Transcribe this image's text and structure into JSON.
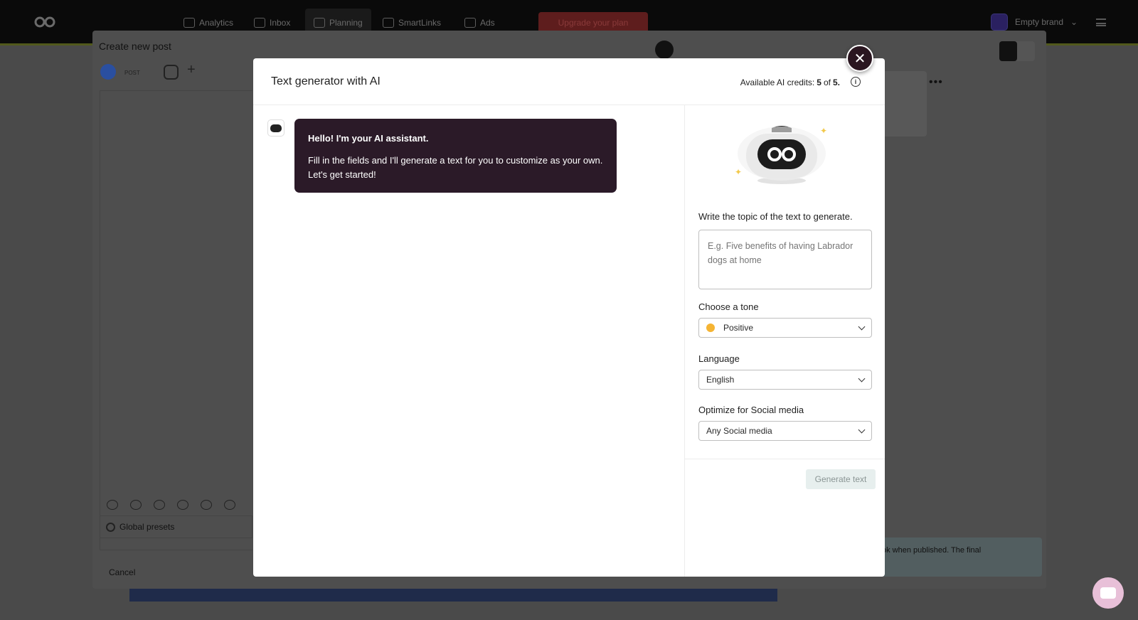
{
  "nav": {
    "items": [
      "Analytics",
      "Inbox",
      "Planning",
      "SmartLinks",
      "Ads"
    ],
    "upgrade_label": "Upgrade your plan",
    "brand_label": "Empty brand"
  },
  "create_post": {
    "title": "Create new post",
    "post_type": "POST",
    "global_presets": "Global presets",
    "cancel": "Cancel",
    "note_text": "ok when published. The final"
  },
  "ai_modal": {
    "title": "Text generator with AI",
    "credits_prefix": "Available AI credits:",
    "credits_used": "5",
    "credits_of": "of",
    "credits_total": "5.",
    "greeting": "Hello! I'm your AI assistant.",
    "intro": "Fill in the fields and I'll generate a text for you to customize as your own. Let's get started!",
    "topic_label": "Write the topic of the text to generate.",
    "topic_placeholder": "E.g. Five benefits of having Labrador dogs at home",
    "tone_label": "Choose a tone",
    "tone_value": "Positive",
    "language_label": "Language",
    "language_value": "English",
    "social_label": "Optimize for Social media",
    "social_value": "Any Social media",
    "generate_label": "Generate text"
  }
}
